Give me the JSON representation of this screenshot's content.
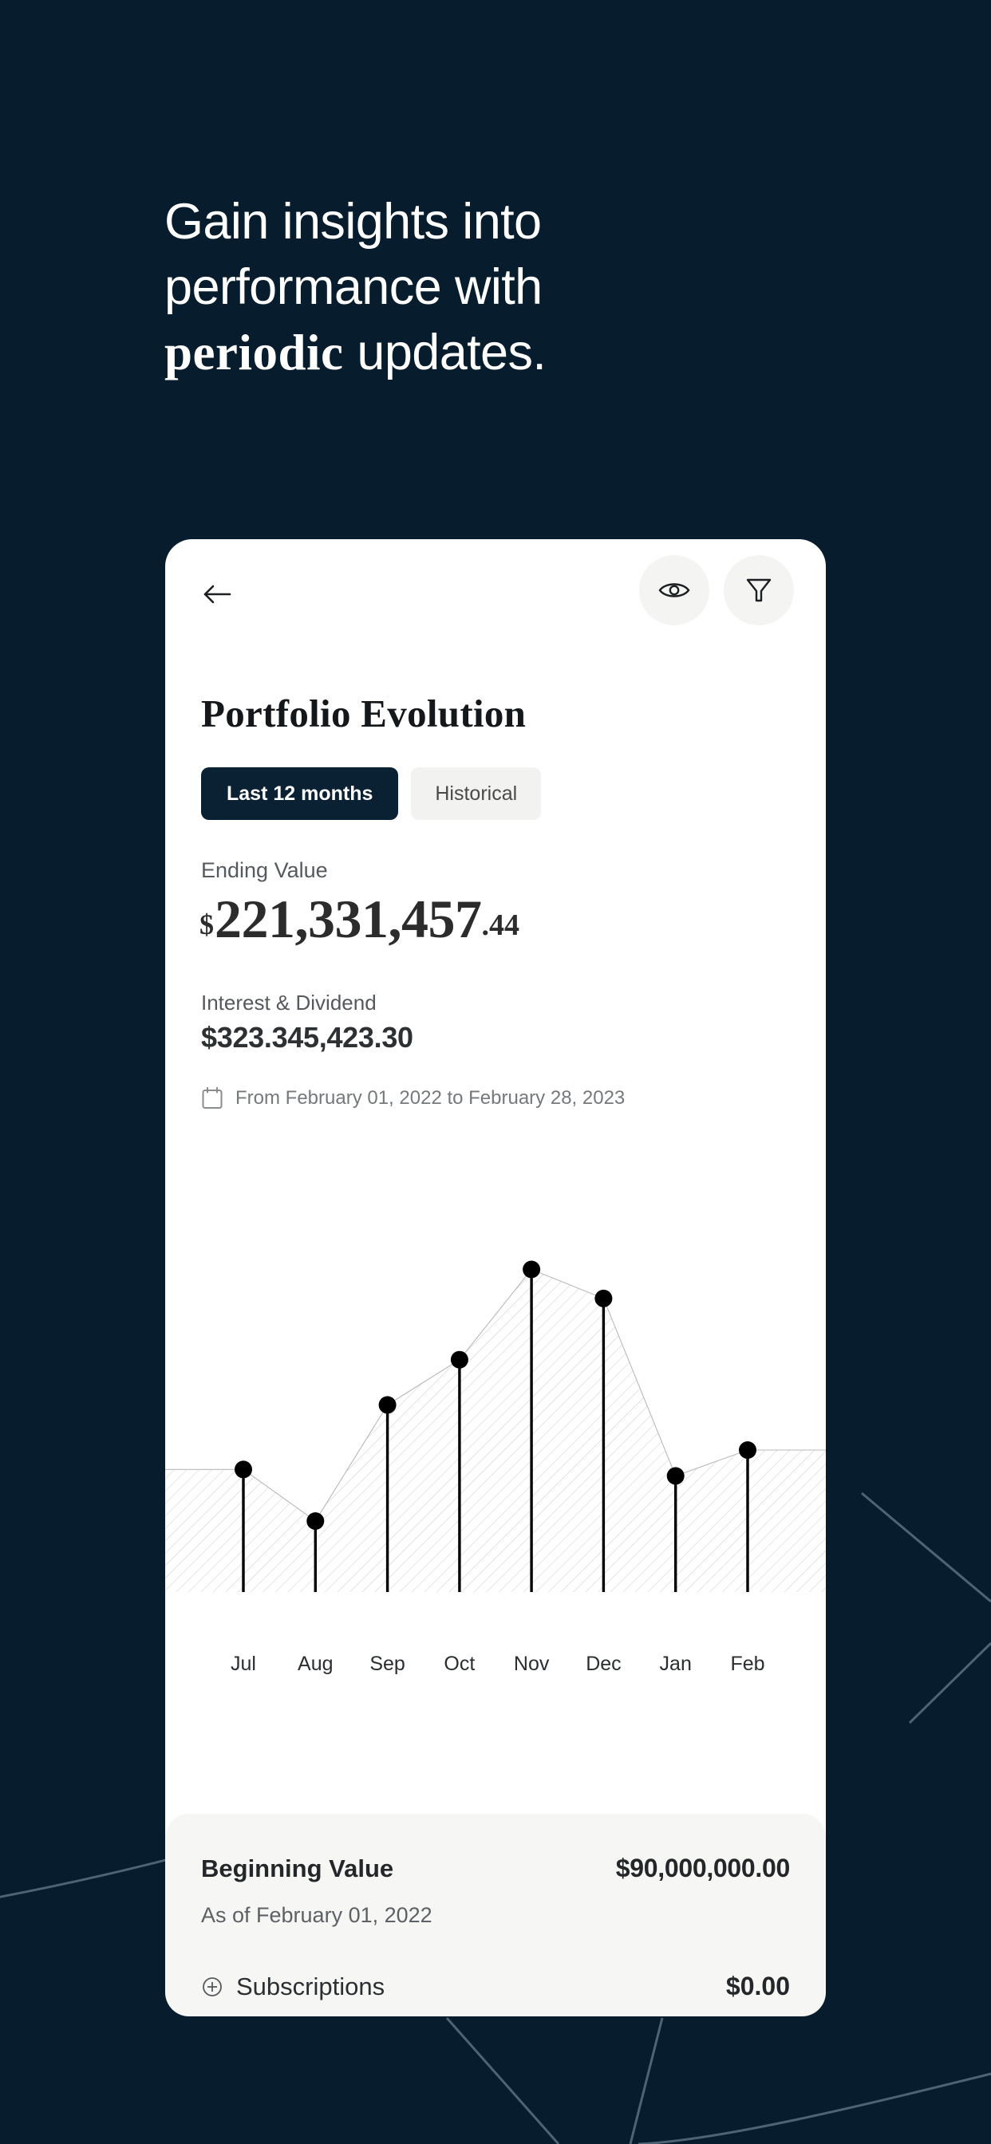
{
  "theme": {
    "background": "#071c2c",
    "card_background": "#ffffff",
    "summary_background": "#f6f6f4",
    "accent_dark": "#0a2133",
    "text_dark": "#24272a",
    "text_muted": "#76797c",
    "decor_line": "#5b7183"
  },
  "hero": {
    "line1": "Gain insights into",
    "line2": "performance with",
    "line3_emphasis": "periodic",
    "line3_rest": " updates."
  },
  "card": {
    "topbar": {
      "back_icon": "arrow-left-icon",
      "eye_icon": "eye-icon",
      "filter_icon": "funnel-filter-icon"
    },
    "title": "Portfolio Evolution",
    "tabs": [
      {
        "label": "Last 12 months",
        "active": true
      },
      {
        "label": "Historical",
        "active": false
      }
    ],
    "ending": {
      "label": "Ending Value",
      "currency": "$",
      "amount": "221,331,457",
      "cents": ".44"
    },
    "interest": {
      "label": "Interest & Dividend",
      "value": "$323.345,423.30"
    },
    "date_range": {
      "icon": "calendar-icon",
      "text": "From February 01, 2022 to February 28, 2023"
    }
  },
  "summary": {
    "beginning_label": "Beginning Value",
    "beginning_value": "$90,000,000.00",
    "as_of_label": "As of February 01, 2022",
    "subscriptions_icon": "plus-circle-icon",
    "subscriptions_label": "Subscriptions",
    "subscriptions_value": "$0.00"
  },
  "chart_data": {
    "type": "line",
    "title": "Portfolio Evolution",
    "xlabel": "",
    "ylabel": "",
    "categories": [
      "Jul",
      "Aug",
      "Sep",
      "Oct",
      "Nov",
      "Dec",
      "Jan",
      "Feb"
    ],
    "values": [
      38,
      22,
      58,
      72,
      100,
      91,
      36,
      44
    ],
    "ylim": [
      0,
      110
    ],
    "grid": false,
    "legend": null,
    "style": {
      "marker": "filled-circle",
      "stems": true,
      "area_fill": "diagonal-hatch",
      "line_color": "#000000"
    }
  }
}
